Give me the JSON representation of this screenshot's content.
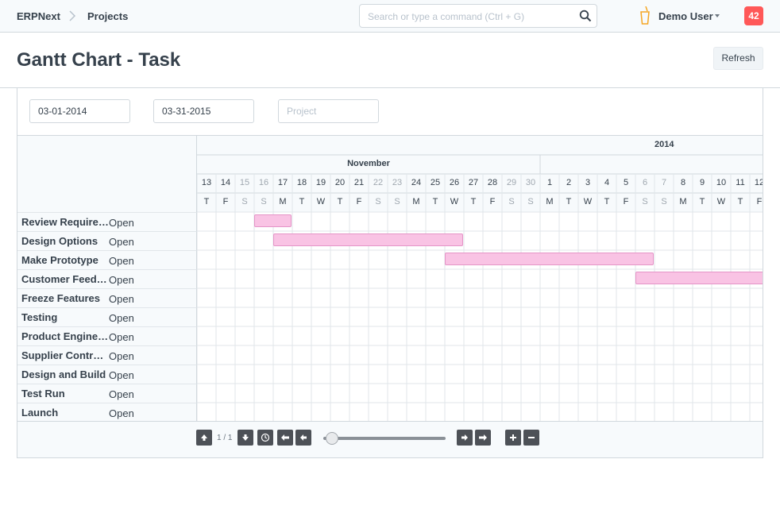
{
  "navbar": {
    "brand": "ERPNext",
    "breadcrumb": "Projects",
    "search_placeholder": "Search or type a command (Ctrl + G)",
    "user": "Demo User",
    "notifications": "42"
  },
  "page": {
    "title": "Gantt Chart - Task",
    "refresh_label": "Refresh"
  },
  "filters": {
    "from_date": "03-01-2014",
    "to_date": "03-31-2015",
    "project_placeholder": "Project"
  },
  "timeline": {
    "year": "2014",
    "month": "November",
    "days": [
      {
        "d": "13",
        "w": "T",
        "we": false
      },
      {
        "d": "14",
        "w": "F",
        "we": false
      },
      {
        "d": "15",
        "w": "S",
        "we": true
      },
      {
        "d": "16",
        "w": "S",
        "we": true
      },
      {
        "d": "17",
        "w": "M",
        "we": false
      },
      {
        "d": "18",
        "w": "T",
        "we": false
      },
      {
        "d": "19",
        "w": "W",
        "we": false
      },
      {
        "d": "20",
        "w": "T",
        "we": false
      },
      {
        "d": "21",
        "w": "F",
        "we": false
      },
      {
        "d": "22",
        "w": "S",
        "we": true
      },
      {
        "d": "23",
        "w": "S",
        "we": true
      },
      {
        "d": "24",
        "w": "M",
        "we": false
      },
      {
        "d": "25",
        "w": "T",
        "we": false
      },
      {
        "d": "26",
        "w": "W",
        "we": false
      },
      {
        "d": "27",
        "w": "T",
        "we": false
      },
      {
        "d": "28",
        "w": "F",
        "we": false
      },
      {
        "d": "29",
        "w": "S",
        "we": true
      },
      {
        "d": "30",
        "w": "S",
        "we": true
      },
      {
        "d": "1",
        "w": "M",
        "we": false
      },
      {
        "d": "2",
        "w": "T",
        "we": false
      },
      {
        "d": "3",
        "w": "W",
        "we": false
      },
      {
        "d": "4",
        "w": "T",
        "we": false
      },
      {
        "d": "5",
        "w": "F",
        "we": false
      },
      {
        "d": "6",
        "w": "S",
        "we": true
      },
      {
        "d": "7",
        "w": "S",
        "we": true
      },
      {
        "d": "8",
        "w": "M",
        "we": false
      },
      {
        "d": "9",
        "w": "T",
        "we": false
      },
      {
        "d": "10",
        "w": "W",
        "we": false
      },
      {
        "d": "11",
        "w": "T",
        "we": false
      },
      {
        "d": "12",
        "w": "F",
        "we": false
      }
    ]
  },
  "tasks": [
    {
      "name": "Review Requirements",
      "status": "Open",
      "start": 3,
      "end": 5
    },
    {
      "name": "Design Options",
      "status": "Open",
      "start": 4,
      "end": 14
    },
    {
      "name": "Make Prototype",
      "status": "Open",
      "start": 13,
      "end": 24
    },
    {
      "name": "Customer Feedback",
      "status": "Open",
      "start": 23,
      "end": 30
    },
    {
      "name": "Freeze Features",
      "status": "Open"
    },
    {
      "name": "Testing",
      "status": "Open"
    },
    {
      "name": "Product Engineering",
      "status": "Open"
    },
    {
      "name": "Supplier Contracts",
      "status": "Open"
    },
    {
      "name": "Design and Build",
      "status": "Open"
    },
    {
      "name": "Test Run",
      "status": "Open"
    },
    {
      "name": "Launch",
      "status": "Open"
    }
  ],
  "footer": {
    "page_indicator": "1 / 1",
    "zoom_level": 0.05
  },
  "colors": {
    "bar_fill": "#f9c3e4",
    "bar_border": "#e594c7",
    "badge": "#ff5858"
  }
}
